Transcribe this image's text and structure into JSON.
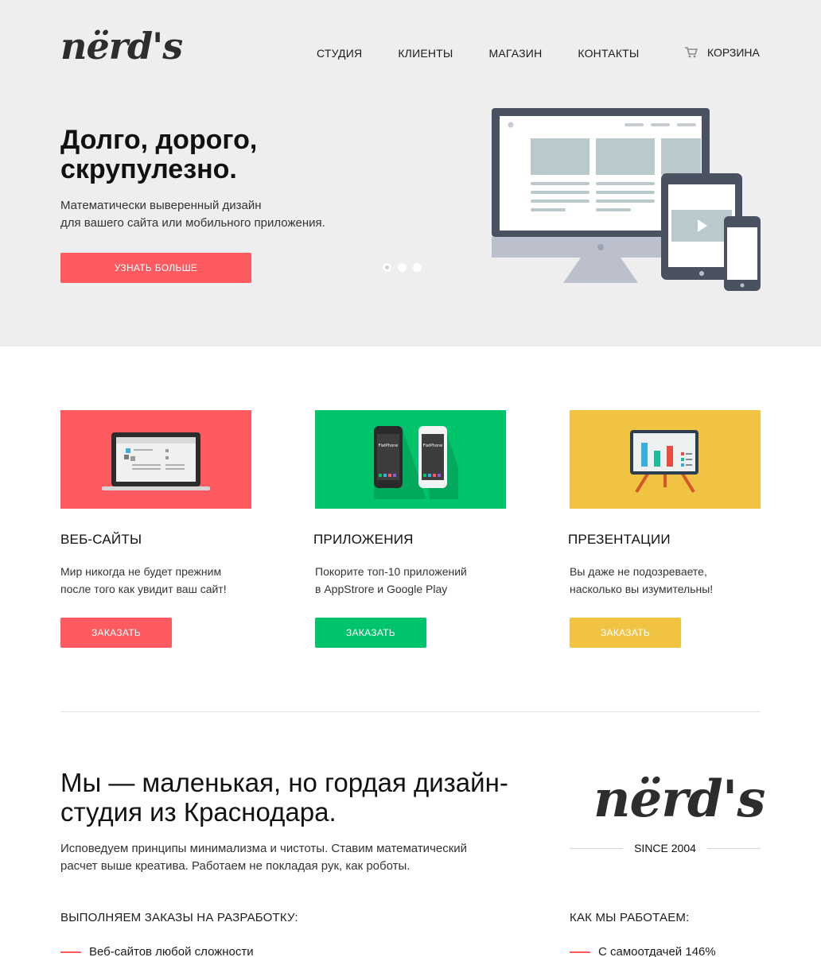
{
  "brand": {
    "logo_text": "nërd's"
  },
  "nav": {
    "items": [
      {
        "label": "СТУДИЯ"
      },
      {
        "label": "КЛИЕНТЫ"
      },
      {
        "label": "МАГАЗИН"
      },
      {
        "label": "КОНТАКТЫ"
      }
    ],
    "cart_label": "КОРЗИНА"
  },
  "hero": {
    "title": "Долго, дорого, скрупулезно.",
    "subtitle_line1": "Математически выверенный дизайн",
    "subtitle_line2": "для вашего сайта или мобильного приложения.",
    "button": "УЗНАТЬ БОЛЬШЕ",
    "slides_total": 3,
    "slide_active": 1
  },
  "services": [
    {
      "title": "ВЕБ-САЙТЫ",
      "line1": "Мир никогда не будет прежним",
      "line2": "после того как увидит ваш сайт!",
      "button": "ЗАКАЗАТЬ",
      "color": "#ff5a5f",
      "icon": "laptop-icon"
    },
    {
      "title": "ПРИЛОЖЕНИЯ",
      "line1": "Покорите топ-10 приложений",
      "line2": "в AppStrore и Google Play",
      "button": "ЗАКАЗАТЬ",
      "color": "#00c46b",
      "icon": "phones-icon"
    },
    {
      "title": "ПРЕЗЕНТАЦИИ",
      "line1": "Вы даже не подозреваете,",
      "line2": "насколько вы изумительны!",
      "button": "ЗАКАЗАТЬ",
      "color": "#f0c442",
      "icon": "presentation-board-icon"
    }
  ],
  "about": {
    "title": "Мы — маленькая, но гордая дизайн-студия из Краснодара.",
    "text_line1": "Исповедуем принципы минимализма и чистоты. Ставим математический",
    "text_line2": "расчет выше креатива. Работаем не покладая рук, как роботы.",
    "since": "SINCE 2004",
    "orders_heading": "ВЫПОЛНЯЕМ ЗАКАЗЫ НА РАЗРАБОТКУ:",
    "orders_first": "Веб-сайтов любой сложности",
    "how_heading": "КАК МЫ РАБОТАЕМ:",
    "how_first": "С самоотдачей 146%"
  },
  "colors": {
    "accent": "#ff5a5f",
    "green": "#00c46b",
    "yellow": "#f0c442",
    "hero_bg": "#eeeeee",
    "device_dark": "#4a5160"
  }
}
